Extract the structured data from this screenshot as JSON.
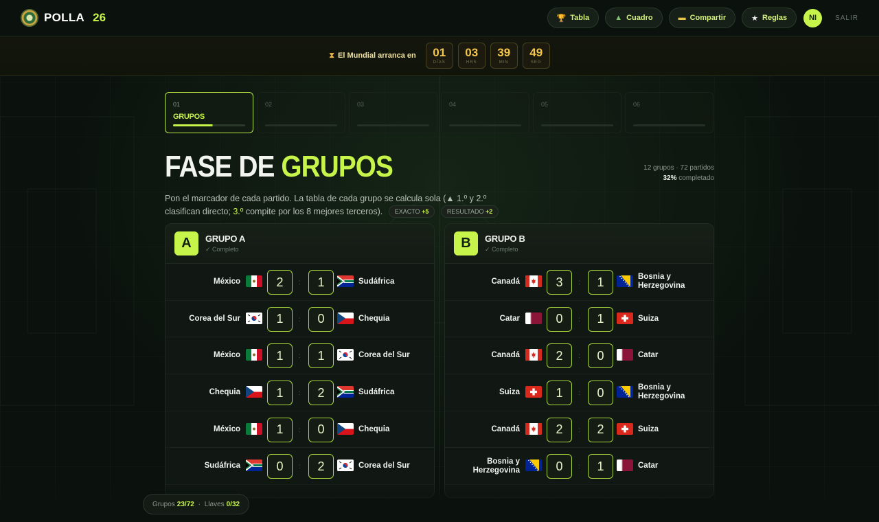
{
  "brand": {
    "name": "POLLA",
    "number": "26"
  },
  "nav": {
    "items": [
      {
        "label": "Tabla",
        "icon": "trophy-icon"
      },
      {
        "label": "Cuadro",
        "icon": "tree-icon"
      },
      {
        "label": "Compartir",
        "icon": "ticket-icon"
      },
      {
        "label": "Reglas",
        "icon": "star-icon"
      }
    ],
    "avatar": "NI",
    "logout": "SALIR"
  },
  "countdown": {
    "label": "El Mundial arranca en",
    "units": [
      {
        "value": "01",
        "unit": "DÍAS"
      },
      {
        "value": "03",
        "unit": "HRS"
      },
      {
        "value": "39",
        "unit": "MIN"
      },
      {
        "value": "49",
        "unit": "SEG"
      }
    ]
  },
  "steps": [
    {
      "num": "01",
      "name": "GRUPOS",
      "active": true,
      "progress": 0.55
    },
    {
      "num": "02",
      "name": ""
    },
    {
      "num": "03",
      "name": ""
    },
    {
      "num": "04",
      "name": ""
    },
    {
      "num": "05",
      "name": ""
    },
    {
      "num": "06",
      "name": ""
    }
  ],
  "phase": {
    "title_main": "FASE DE",
    "title_accent": "GRUPOS",
    "stats_line1": "12 grupos · 72 partidos",
    "stats_percent": "32%",
    "stats_suffix": "completado",
    "desc_1": "Pon el marcador de cada partido. La tabla de cada grupo se calcula sola (",
    "desc_2": "▲ 1.º y 2.º",
    "desc_3": "clasifican directo; ",
    "desc_4": "3.º",
    "desc_5": " compite por los 8 mejores terceros).",
    "pill_exact_label": "EXACTO",
    "pill_exact_pts": "+5",
    "pill_result_label": "RESULTADO",
    "pill_result_pts": "+2"
  },
  "groups": [
    {
      "letter": "A",
      "name": "GRUPO A",
      "status": "✓ Completo",
      "matches": [
        {
          "home": "México",
          "home_flag": "mx",
          "hs": "2",
          "as": "1",
          "away": "Sudáfrica",
          "away_flag": "za"
        },
        {
          "home": "Corea del Sur",
          "home_flag": "kr",
          "hs": "1",
          "as": "0",
          "away": "Chequia",
          "away_flag": "cz"
        },
        {
          "home": "México",
          "home_flag": "mx",
          "hs": "1",
          "as": "1",
          "away": "Corea del Sur",
          "away_flag": "kr"
        },
        {
          "home": "Chequia",
          "home_flag": "cz",
          "hs": "1",
          "as": "2",
          "away": "Sudáfrica",
          "away_flag": "za"
        },
        {
          "home": "México",
          "home_flag": "mx",
          "hs": "1",
          "as": "0",
          "away": "Chequia",
          "away_flag": "cz"
        },
        {
          "home": "Sudáfrica",
          "home_flag": "za",
          "hs": "0",
          "as": "2",
          "away": "Corea del Sur",
          "away_flag": "kr"
        }
      ]
    },
    {
      "letter": "B",
      "name": "GRUPO B",
      "status": "✓ Completo",
      "matches": [
        {
          "home": "Canadá",
          "home_flag": "ca",
          "hs": "3",
          "as": "1",
          "away": "Bosnia y Herzegovina",
          "away_flag": "ba"
        },
        {
          "home": "Catar",
          "home_flag": "qa",
          "hs": "0",
          "as": "1",
          "away": "Suiza",
          "away_flag": "ch"
        },
        {
          "home": "Canadá",
          "home_flag": "ca",
          "hs": "2",
          "as": "0",
          "away": "Catar",
          "away_flag": "qa"
        },
        {
          "home": "Suiza",
          "home_flag": "ch",
          "hs": "1",
          "as": "0",
          "away": "Bosnia y Herzegovina",
          "away_flag": "ba"
        },
        {
          "home": "Canadá",
          "home_flag": "ca",
          "hs": "2",
          "as": "2",
          "away": "Suiza",
          "away_flag": "ch"
        },
        {
          "home": "Bosnia y Herzegovina",
          "home_flag": "ba",
          "hs": "0",
          "as": "1",
          "away": "Catar",
          "away_flag": "qa"
        }
      ]
    }
  ],
  "footer": {
    "groups_label": "Grupos",
    "groups_value": "23/72",
    "separator": " · ",
    "knockout_label": "Llaves",
    "knockout_value": "0/32"
  }
}
